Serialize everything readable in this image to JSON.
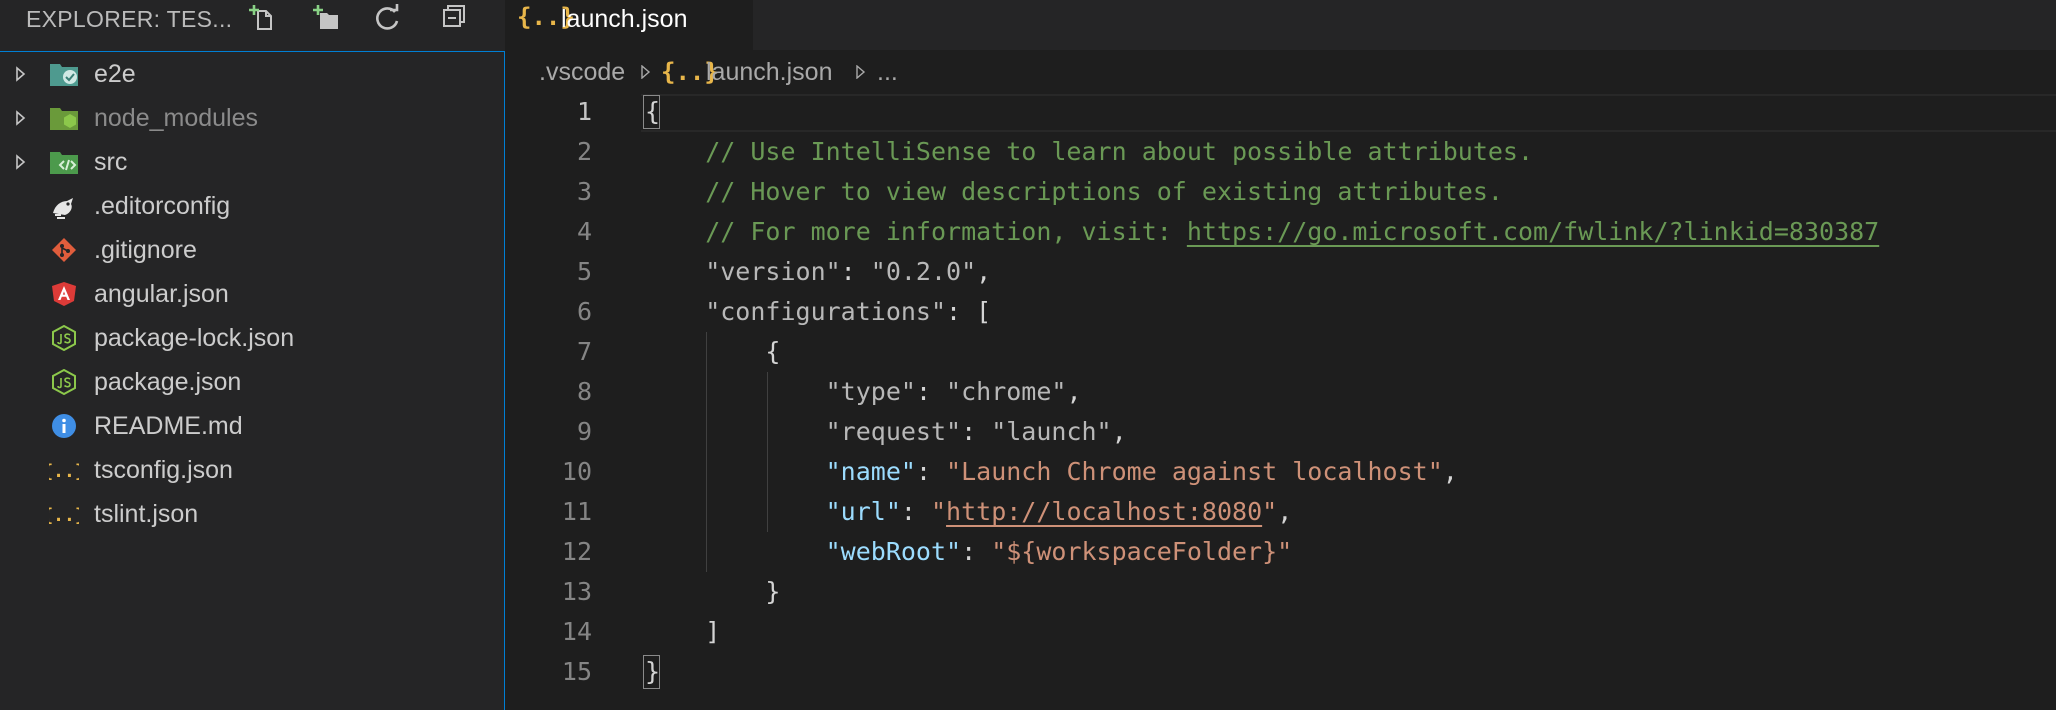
{
  "sidebar": {
    "title": "EXPLORER: TES...",
    "actions": {
      "new_file": "new-file-icon",
      "new_folder": "new-folder-icon",
      "refresh": "refresh-icon",
      "collapse": "collapse-all-icon"
    },
    "items": [
      {
        "label": "e2e",
        "kind": "folder",
        "icon": "folder-e2e-icon"
      },
      {
        "label": "node_modules",
        "kind": "folder",
        "icon": "folder-node-icon",
        "dimmed": true
      },
      {
        "label": "src",
        "kind": "folder",
        "icon": "folder-src-icon"
      },
      {
        "label": ".editorconfig",
        "kind": "file",
        "icon": "editorconfig-icon"
      },
      {
        "label": ".gitignore",
        "kind": "file",
        "icon": "git-icon"
      },
      {
        "label": "angular.json",
        "kind": "file",
        "icon": "angular-icon"
      },
      {
        "label": "package-lock.json",
        "kind": "file",
        "icon": "nodejs-icon"
      },
      {
        "label": "package.json",
        "kind": "file",
        "icon": "nodejs-icon"
      },
      {
        "label": "README.md",
        "kind": "file",
        "icon": "info-icon"
      },
      {
        "label": "tsconfig.json",
        "kind": "file",
        "icon": "json-icon"
      },
      {
        "label": "tslint.json",
        "kind": "file",
        "icon": "json-icon"
      }
    ]
  },
  "editor": {
    "tab": {
      "icon_glyph": "{..}",
      "label": "launch.json"
    },
    "breadcrumbs": {
      "folder": ".vscode",
      "file_icon": "{..}",
      "file": "launch.json",
      "more": "..."
    },
    "active_line": 1,
    "lines": [
      {
        "n": "1",
        "segs": [
          [
            "c-punc",
            "{"
          ]
        ]
      },
      {
        "n": "2",
        "segs": [
          [
            "c-comment",
            "    // Use IntelliSense to learn about possible attributes."
          ]
        ]
      },
      {
        "n": "3",
        "segs": [
          [
            "c-comment",
            "    // Hover to view descriptions of existing attributes."
          ]
        ]
      },
      {
        "n": "4",
        "segs": [
          [
            "c-comment",
            "    // For more information, visit: "
          ],
          [
            "c-comment link",
            "https://go.microsoft.com/fwlink/?linkid=830387"
          ]
        ]
      },
      {
        "n": "5",
        "segs": [
          [
            "c-key-dim",
            "    \"version\""
          ],
          [
            "c-punc",
            ": "
          ],
          [
            "c-str-dim",
            "\"0.2.0\""
          ],
          [
            "c-punc",
            ","
          ]
        ]
      },
      {
        "n": "6",
        "segs": [
          [
            "c-key-dim",
            "    \"configurations\""
          ],
          [
            "c-punc",
            ": ["
          ]
        ]
      },
      {
        "n": "7",
        "segs": [
          [
            "c-punc",
            "        {"
          ]
        ]
      },
      {
        "n": "8",
        "segs": [
          [
            "c-key-dim",
            "            \"type\""
          ],
          [
            "c-punc",
            ": "
          ],
          [
            "c-str-dim",
            "\"chrome\""
          ],
          [
            "c-punc",
            ","
          ]
        ]
      },
      {
        "n": "9",
        "segs": [
          [
            "c-key-dim",
            "            \"request\""
          ],
          [
            "c-punc",
            ": "
          ],
          [
            "c-str-dim",
            "\"launch\""
          ],
          [
            "c-punc",
            ","
          ]
        ]
      },
      {
        "n": "10",
        "segs": [
          [
            "c-key",
            "            \"name\""
          ],
          [
            "c-punc",
            ": "
          ],
          [
            "c-str",
            "\"Launch Chrome against localhost\""
          ],
          [
            "c-punc",
            ","
          ]
        ]
      },
      {
        "n": "11",
        "segs": [
          [
            "c-key",
            "            \"url\""
          ],
          [
            "c-punc",
            ": "
          ],
          [
            "c-str",
            "\""
          ],
          [
            "c-str link",
            "http://localhost:8080"
          ],
          [
            "c-str",
            "\""
          ],
          [
            "c-punc",
            ","
          ]
        ]
      },
      {
        "n": "12",
        "segs": [
          [
            "c-key",
            "            \"webRoot\""
          ],
          [
            "c-punc",
            ": "
          ],
          [
            "c-str",
            "\"${workspaceFolder}\""
          ]
        ]
      },
      {
        "n": "13",
        "segs": [
          [
            "c-punc",
            "        }"
          ]
        ]
      },
      {
        "n": "14",
        "segs": [
          [
            "c-punc",
            "    ]"
          ]
        ]
      },
      {
        "n": "15",
        "segs": [
          [
            "c-punc",
            "}"
          ]
        ]
      }
    ]
  },
  "colors": {
    "background": "#1e1e1e",
    "sidebar": "#252526",
    "focus_border": "#007fd4",
    "comment": "#6a9955",
    "key": "#9cdcfe",
    "string": "#ce9178",
    "json_icon": "#e8b64a"
  }
}
